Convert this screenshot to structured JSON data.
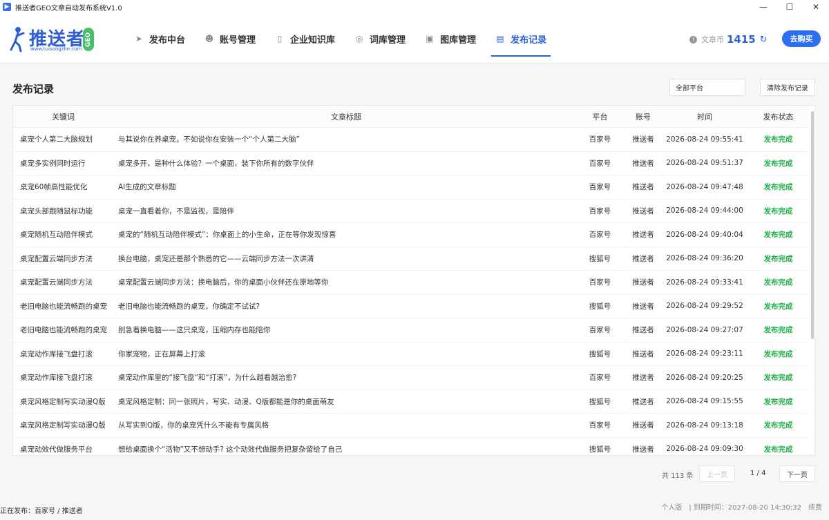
{
  "window": {
    "title": "推送者GEO文章自动发布系统V1.0",
    "controls": {
      "minimize": "—",
      "maximize": "☐",
      "close": "✕"
    }
  },
  "logo": {
    "text": "推送者",
    "url": "www.tuisongzhe.com",
    "badge": "GEO",
    "brand_color": "#2d5fd3"
  },
  "nav": {
    "items": [
      {
        "label": "发布中台",
        "icon": "send-icon",
        "glyph": "➤"
      },
      {
        "label": "账号管理",
        "icon": "users-icon",
        "glyph": "👥"
      },
      {
        "label": "企业知识库",
        "icon": "book-icon",
        "glyph": "▯"
      },
      {
        "label": "词库管理",
        "icon": "target-icon",
        "glyph": "◎"
      },
      {
        "label": "图库管理",
        "icon": "image-icon",
        "glyph": "▣"
      },
      {
        "label": "发布记录",
        "icon": "record-icon",
        "glyph": "▤"
      }
    ],
    "active_index": 5
  },
  "coins": {
    "label": "文章币",
    "value": "1415"
  },
  "buy_button": "去购买",
  "page": {
    "title": "发布记录",
    "platform_filter": "全部平台",
    "clear_button": "清除发布记录"
  },
  "table": {
    "columns": {
      "keyword": "关键词",
      "title": "文章标题",
      "platform": "平台",
      "account": "账号",
      "time": "时间",
      "status": "发布状态"
    },
    "rows": [
      {
        "keyword": "桌宠个人第二大脑规划",
        "title": "与其说你在养桌宠，不如说你在安装一个“个人第二大脑”",
        "platform": "百家号",
        "account": "推送者",
        "time": "2026-08-24 09:55:41",
        "status": "发布完成"
      },
      {
        "keyword": "桌宠多实例同时运行",
        "title": "桌宠多开，是种什么体验？一个桌面，装下你所有的数字伙伴",
        "platform": "百家号",
        "account": "推送者",
        "time": "2026-08-24 09:51:37",
        "status": "发布完成"
      },
      {
        "keyword": "桌宠60帧高性能优化",
        "title": "AI生成的文章标题",
        "platform": "百家号",
        "account": "推送者",
        "time": "2026-08-24 09:47:48",
        "status": "发布完成"
      },
      {
        "keyword": "桌宠头部跟随鼠标功能",
        "title": "桌宠一直看着你，不是监视，是陪伴",
        "platform": "百家号",
        "account": "推送者",
        "time": "2026-08-24 09:44:00",
        "status": "发布完成"
      },
      {
        "keyword": "桌宠随机互动陪伴模式",
        "title": "桌宠的“随机互动陪伴模式”：你桌面上的小生命，正在等你发现惊喜",
        "platform": "百家号",
        "account": "推送者",
        "time": "2026-08-24 09:40:04",
        "status": "发布完成"
      },
      {
        "keyword": "桌宠配置云端同步方法",
        "title": "换台电脑，桌宠还是那个熟悉的它——云端同步方法一次讲清",
        "platform": "搜狐号",
        "account": "推送者",
        "time": "2026-08-24 09:36:20",
        "status": "发布完成"
      },
      {
        "keyword": "桌宠配置云端同步方法",
        "title": "桌宠配置云端同步方法：换电脑后，你的桌面小伙伴还在原地等你",
        "platform": "百家号",
        "account": "推送者",
        "time": "2026-08-24 09:33:41",
        "status": "发布完成"
      },
      {
        "keyword": "老旧电脑也能流畅跑的桌宠",
        "title": "老旧电脑也能流畅跑的桌宠，你确定不试试?",
        "platform": "搜狐号",
        "account": "推送者",
        "time": "2026-08-24 09:29:52",
        "status": "发布完成"
      },
      {
        "keyword": "老旧电脑也能流畅跑的桌宠",
        "title": "别急着换电脑——这只桌宠，压缩内存也能陪你",
        "platform": "百家号",
        "account": "推送者",
        "time": "2026-08-24 09:27:07",
        "status": "发布完成"
      },
      {
        "keyword": "桌宠动作库接飞盘打滚",
        "title": "你家宠物，正在屏幕上打滚",
        "platform": "搜狐号",
        "account": "推送者",
        "time": "2026-08-24 09:23:11",
        "status": "发布完成"
      },
      {
        "keyword": "桌宠动作库接飞盘打滚",
        "title": "桌宠动作库里的“接飞盘”和“打滚”，为什么越看越治愈?",
        "platform": "百家号",
        "account": "推送者",
        "time": "2026-08-24 09:20:25",
        "status": "发布完成"
      },
      {
        "keyword": "桌宠风格定制写实动漫Q版",
        "title": "桌宠风格定制：同一张照片，写实、动漫、Q版都能是你的桌面萌友",
        "platform": "搜狐号",
        "account": "推送者",
        "time": "2026-08-24 09:15:55",
        "status": "发布完成"
      },
      {
        "keyword": "桌宠风格定制写实动漫Q版",
        "title": "从写实到Q版，你的桌宠凭什么不能有专属风格",
        "platform": "百家号",
        "account": "推送者",
        "time": "2026-08-24 09:13:18",
        "status": "发布完成"
      },
      {
        "keyword": "桌宠动效代做服务平台",
        "title": "想给桌面换个“活物”又不想动手? 这个动效代做服务把复杂留给了自己",
        "platform": "搜狐号",
        "account": "推送者",
        "time": "2026-08-24 09:09:30",
        "status": "发布完成"
      }
    ]
  },
  "pagination": {
    "total": "共 113 条",
    "prev": "上一页",
    "page": "1 / 4",
    "next": "下一页"
  },
  "statusbar": {
    "left": "正在发布：百家号 / 推送者",
    "version": "个人版",
    "expiry": "| 到期时间：2027-08-20 14:30:32",
    "renew": "续费"
  },
  "colors": {
    "accent": "#2d5fd3",
    "success": "#22b14c",
    "button": "#2d6ff0"
  }
}
